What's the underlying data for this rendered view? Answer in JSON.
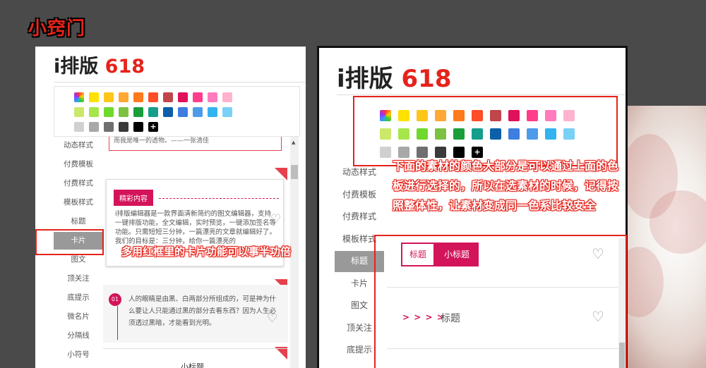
{
  "heading": "小窍门",
  "logo": {
    "brand": "i排版",
    "num": "618"
  },
  "left_panel": {
    "sidebar": [
      "动态样式",
      "付费模板",
      "付费样式",
      "模板样式",
      "标题",
      "卡片",
      "图文",
      "顶关注",
      "底提示",
      "微名片",
      "分隔线",
      "小符号"
    ],
    "active_index": 5,
    "top_snippet": "而我是唯一的透物。——一张清佳",
    "card1": {
      "tag": "精彩内容",
      "text": "i排版编辑器是一款界面清新简约的图文编辑器，支持一键排版功能，全文编辑，实时预览，一键添加签名等功能。只需短短三分钟，一篇漂亮的文章就编辑好了。我们的目标是：三分钟，给你一篇漂亮的"
    },
    "card2": {
      "num": "01",
      "text": "人的眼睛是由黑、白两部分所组成的，可是神为什么要让人只能通过黑的部分去看东西？因为人生必须透过黑暗，才能看到光明。"
    },
    "bottom_snippet": "小标题"
  },
  "right_panel": {
    "sidebar": [
      "动态样式",
      "付费模板",
      "付费样式",
      "模板样式",
      "标题",
      "卡片",
      "图文",
      "顶关注",
      "底提示"
    ],
    "active_index": 4,
    "title_tabs": {
      "outline": "标题",
      "filled": "小标题"
    },
    "arrow_item": {
      "arrows": "> > > >",
      "label": "标题"
    }
  },
  "annotations": {
    "left": "多用红框里的卡片功能可以事半功倍",
    "right": "下面的素材的颜色大部分是可以通过上面的色板进行选择的，所以在选素材的时候，记得按照整体性，让素材变成同一色系比较安全"
  },
  "palette": {
    "row1": [
      "#ffe100",
      "#ffc61a",
      "#ffa833",
      "#ff7a1a",
      "#ff4d26",
      "#c0464b",
      "#e0105a",
      "#ff3d8b",
      "#ff7bbd",
      "#ffb3cf"
    ],
    "row2": [
      "#cbe86b",
      "#a6e64a",
      "#6fd92b",
      "#7cc142",
      "#1a9e3a",
      "#159e8c",
      "#0c5fa8",
      "#3d7ee0",
      "#4c9be8",
      "#33b3f0",
      "#7ad0f5"
    ],
    "row3": [
      "#d0d0d0",
      "#a8a8a8",
      "#6f6f6f",
      "#3a3a3a",
      "#000000"
    ],
    "add_label": "+"
  },
  "colors": {
    "accent": "#e5231b",
    "card_pink": "#d4145a",
    "gray_active": "#999999"
  }
}
